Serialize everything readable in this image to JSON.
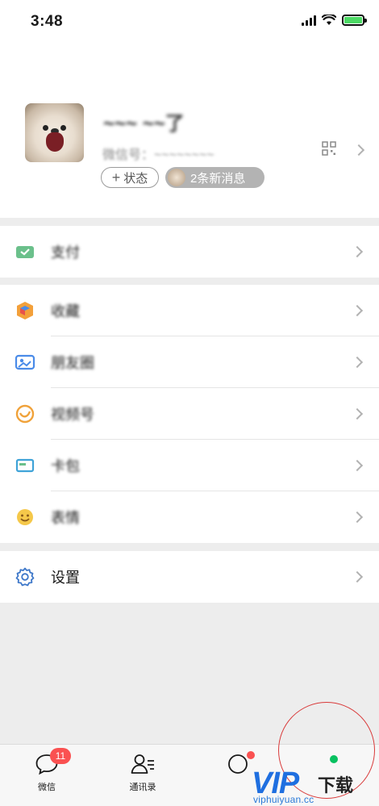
{
  "status_bar": {
    "time": "3:48"
  },
  "profile": {
    "nickname": "~~~ ~~了",
    "wechat_id": "微信号：~~~~~~~~",
    "status_button": "状态",
    "news_pill": "2条新消息"
  },
  "menu": {
    "pay": "支付",
    "favorites": "收藏",
    "moments": "朋友圈",
    "channels": "视频号",
    "cards": "卡包",
    "stickers": "表情",
    "settings": "设置"
  },
  "tabbar": {
    "chats": "微信",
    "chats_badge": "11",
    "contacts": "通讯录"
  },
  "watermark": {
    "brand": "VIP",
    "suffix": "下载",
    "url": "viphuiyuan.cc"
  },
  "colors": {
    "accent_green": "#07c160",
    "badge_red": "#fa5151",
    "watermark_blue": "#1f6fe0"
  }
}
